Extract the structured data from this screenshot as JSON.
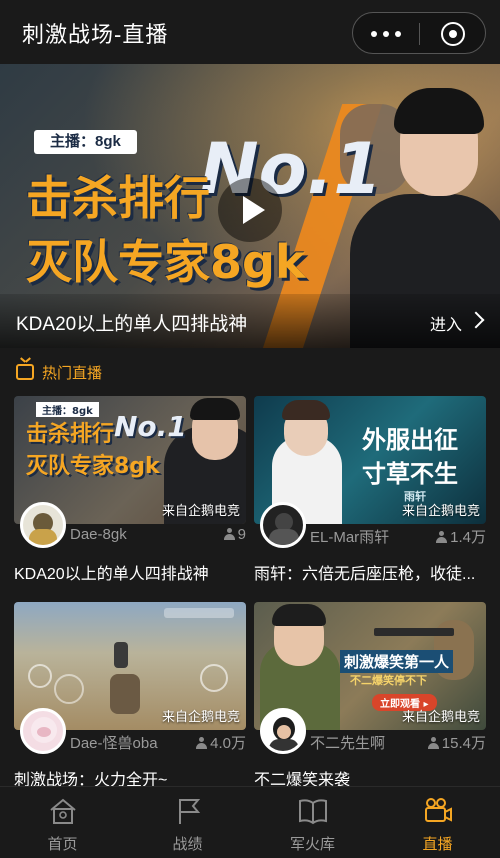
{
  "header": {
    "title": "刺激战场-直播",
    "more_icon": "more-dots-icon",
    "close_icon": "target-close-icon"
  },
  "hero": {
    "banner_host": "主播：8gk",
    "banner_line1": "击杀排行",
    "banner_no1": "No.1",
    "banner_line2": "灭队专家8gk",
    "caption": "KDA20以上的单人四排战神",
    "enter_label": "进入",
    "play_icon": "play-icon"
  },
  "section": {
    "title": "热门直播",
    "icon": "tv-icon"
  },
  "streams": [
    {
      "source": "来自企鹅电竞",
      "anchor": "Dae-8gk",
      "viewers": "9",
      "title": "KDA20以上的单人四排战神",
      "thumb_line1": "击杀排行",
      "thumb_no1": "No.1",
      "thumb_line2": "灭队专家8gk",
      "thumb_host": "主播：8gk"
    },
    {
      "source": "来自企鹅电竞",
      "anchor": "EL-Mar雨轩",
      "viewers": "1.4万",
      "title": "雨轩：六倍无后座压枪，收徒...",
      "thumb_line1": "外服出征",
      "thumb_line2": "寸草不生",
      "thumb_tag": "雨轩"
    },
    {
      "source": "来自企鹅电竞",
      "anchor": "Dae-怪兽oba",
      "viewers": "4.0万",
      "title": "刺激战场：火力全开~"
    },
    {
      "source": "来自企鹅电竞",
      "anchor": "不二先生啊",
      "viewers": "15.4万",
      "title": "不二爆笑来袭",
      "thumb_line1": "刺激爆笑第一人",
      "thumb_line2": "不二爆笑停不下",
      "thumb_button": "立即观看 ▸"
    }
  ],
  "tabbar": {
    "items": [
      {
        "label": "首页",
        "icon": "home-icon",
        "active": false
      },
      {
        "label": "战绩",
        "icon": "flag-icon",
        "active": false
      },
      {
        "label": "军火库",
        "icon": "book-icon",
        "active": false
      },
      {
        "label": "直播",
        "icon": "video-camera-icon",
        "active": true
      }
    ]
  },
  "colors": {
    "background": "#1a1a1a",
    "accent": "#f5a623",
    "muted_text": "#9a9a9a",
    "text": "#ffffff"
  }
}
